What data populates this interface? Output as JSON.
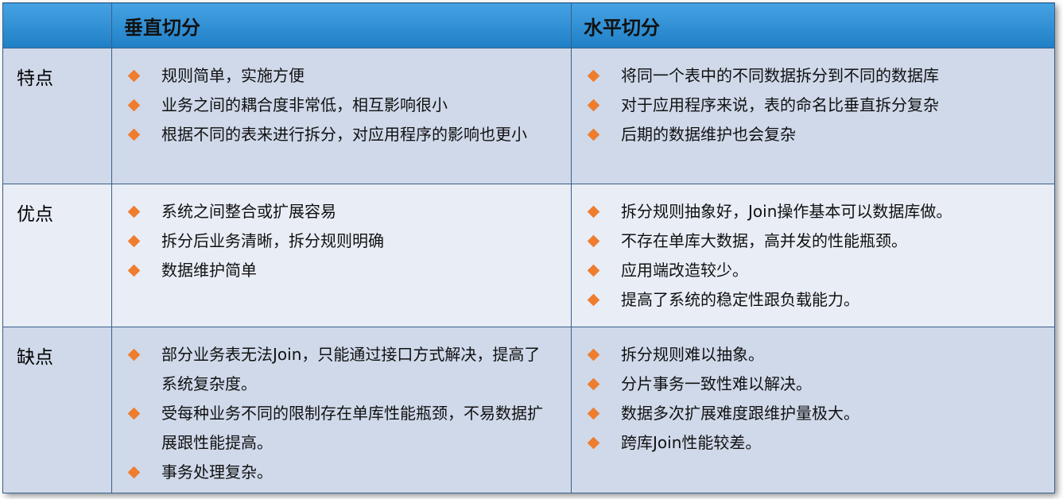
{
  "header": {
    "corner": "",
    "vertical": "垂直切分",
    "horizontal": "水平切分"
  },
  "rows": [
    {
      "label": "特点",
      "vertical": [
        "规则简单，实施方便",
        "业务之间的耦合度非常低，相互影响很小",
        "根据不同的表来进行拆分，对应用程序的影响也更小"
      ],
      "horizontal": [
        "将同一个表中的不同数据拆分到不同的数据库",
        "对于应用程序来说，表的命名比垂直拆分复杂",
        "后期的数据维护也会复杂"
      ]
    },
    {
      "label": "优点",
      "vertical": [
        "系统之间整合或扩展容易",
        "拆分后业务清晰，拆分规则明确",
        "数据维护简单"
      ],
      "horizontal": [
        "拆分规则抽象好，Join操作基本可以数据库做。",
        "不存在单库大数据，高并发的性能瓶颈。",
        "应用端改造较少。",
        "提高了系统的稳定性跟负载能力。"
      ]
    },
    {
      "label": "缺点",
      "vertical": [
        "部分业务表无法Join，只能通过接口方式解决，提高了系统复杂度。",
        "受每种业务不同的限制存在单库性能瓶颈，不易数据扩展跟性能提高。",
        "事务处理复杂。"
      ],
      "horizontal": [
        "拆分规则难以抽象。",
        "分片事务一致性难以解决。",
        "数据多次扩展难度跟维护量极大。",
        "跨库Join性能较差。"
      ]
    }
  ],
  "colors": {
    "header": "#2f8fd6",
    "border": "#3a5f8a",
    "row_dark": "#cfd9ea",
    "row_light": "#e8edf6",
    "bullet": "#ee7d2e"
  },
  "icons": {
    "bullet": "diamond-bullet-icon"
  }
}
